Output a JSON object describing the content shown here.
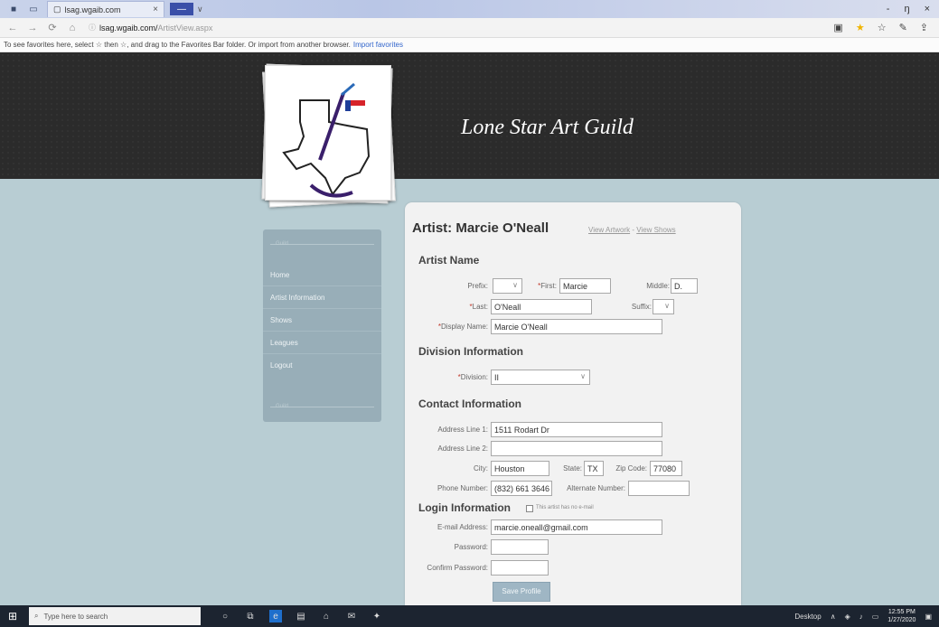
{
  "browser": {
    "tab_title": "lsag.wgaib.com",
    "tab_close": "×",
    "newtab": "—",
    "tab_chevron": "∨",
    "window_min": "-",
    "window_max": "ŋ",
    "window_close": "×",
    "nav_back": "←",
    "nav_forward": "→",
    "nav_refresh": "⟳",
    "nav_home": "⌂",
    "url_host": "lsag.wgaib.com/",
    "url_path": "ArtistView.aspx",
    "favbar_text": "To see favorites here, select ☆ then ☆, and drag to the Favorites Bar folder. Or import from another browser.",
    "favbar_link": "Import favorites"
  },
  "site": {
    "title": "Lone Star Art Guild",
    "nav_separator_top": "Guild",
    "nav_separator_bottom": "Guild",
    "nav_items": [
      "Home",
      "Artist Information",
      "Shows",
      "Leagues",
      "Logout"
    ]
  },
  "artist": {
    "heading": "Artist: Marcie O'Neall",
    "link_artwork": "View Artwork",
    "link_sep": "-",
    "link_shows": "View Shows"
  },
  "form": {
    "section_name": "Artist Name",
    "prefix_label": "Prefix:",
    "prefix_value": "",
    "first_label": "First:",
    "first_value": "Marcie",
    "middle_label": "Middle:",
    "middle_value": "D.",
    "last_label": "Last:",
    "last_value": "O'Neall",
    "suffix_label": "Suffix:",
    "suffix_value": "",
    "display_label": "Display Name:",
    "display_value": "Marcie O'Neall",
    "section_division": "Division Information",
    "division_label": "Division:",
    "division_value": "II",
    "section_contact": "Contact Information",
    "addr1_label": "Address Line 1:",
    "addr1_value": "1511 Rodart Dr",
    "addr2_label": "Address Line 2:",
    "addr2_value": "",
    "city_label": "City:",
    "city_value": "Houston",
    "state_label": "State:",
    "state_value": "TX",
    "zip_label": "Zip Code:",
    "zip_value": "77080",
    "phone_label": "Phone Number:",
    "phone_value": "(832) 661 3646",
    "alt_label": "Alternate Number:",
    "alt_value": "",
    "section_login": "Login Information",
    "no_email_label": "This artist has no e-mail",
    "email_label": "E-mail Address:",
    "email_value": "marcie.oneall@gmail.com",
    "password_label": "Password:",
    "confirm_label": "Confirm Password:",
    "save_label": "Save Profile"
  },
  "taskbar": {
    "search_placeholder": "Type here to search",
    "desktop_label": "Desktop",
    "time": "12:55 PM",
    "date": "1/27/2020"
  },
  "colors": {
    "page_bg": "#b8cdd3",
    "header_bg": "#2b2b2b",
    "nav_bg": "#98aeb8",
    "panel_bg": "#f2f2f2",
    "required": "#c0392b"
  }
}
